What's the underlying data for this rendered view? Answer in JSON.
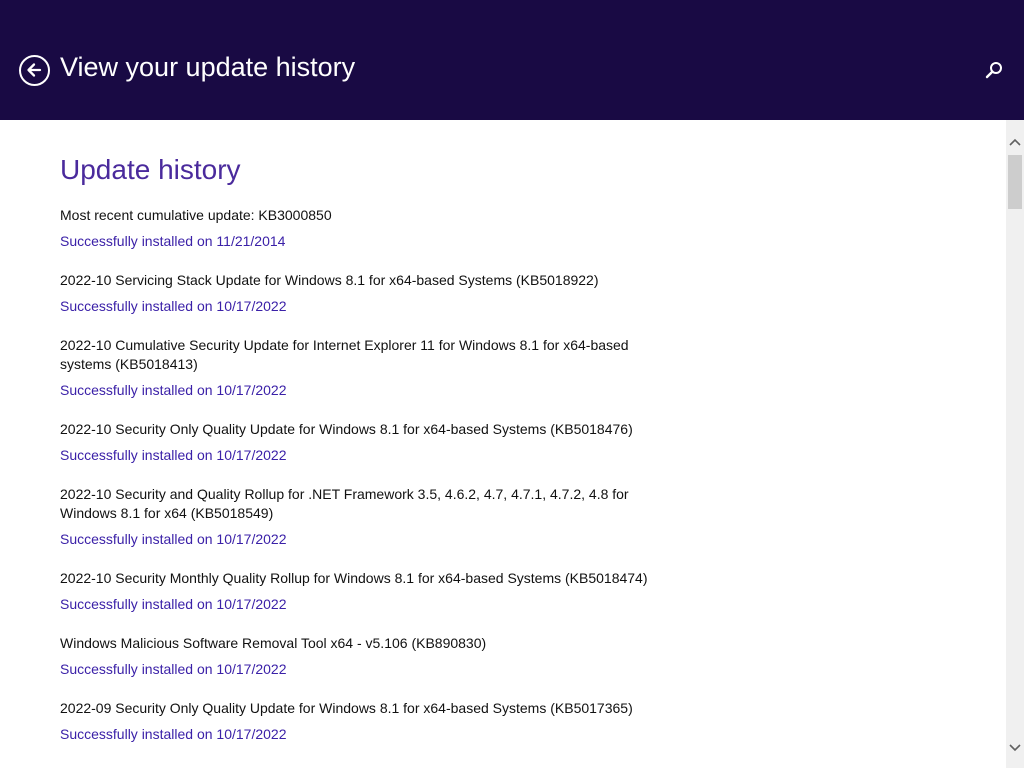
{
  "header": {
    "title": "View your update history",
    "back_icon": "back-arrow-icon",
    "search_icon": "search-icon",
    "background_color": "#190a44"
  },
  "main": {
    "section_title": "Update history",
    "accent_color": "#4a2a9c",
    "status_color": "#3b21a8",
    "updates": [
      {
        "name": "Most recent cumulative update: KB3000850",
        "status": "Successfully installed on 11/21/2014"
      },
      {
        "name": "2022-10 Servicing Stack Update for Windows 8.1 for x64-based Systems (KB5018922)",
        "status": "Successfully installed on 10/17/2022"
      },
      {
        "name": "2022-10 Cumulative Security Update for Internet Explorer 11 for Windows 8.1 for x64-based systems (KB5018413)",
        "status": "Successfully installed on 10/17/2022"
      },
      {
        "name": "2022-10 Security Only Quality Update for Windows 8.1 for x64-based Systems (KB5018476)",
        "status": "Successfully installed on 10/17/2022"
      },
      {
        "name": "2022-10 Security and Quality Rollup for .NET Framework 3.5, 4.6.2, 4.7, 4.7.1, 4.7.2, 4.8 for Windows 8.1 for x64 (KB5018549)",
        "status": "Successfully installed on 10/17/2022"
      },
      {
        "name": "2022-10 Security Monthly Quality Rollup for Windows 8.1 for x64-based Systems (KB5018474)",
        "status": "Successfully installed on 10/17/2022"
      },
      {
        "name": "Windows Malicious Software Removal Tool x64 - v5.106 (KB890830)",
        "status": "Successfully installed on 10/17/2022"
      },
      {
        "name": "2022-09 Security Only Quality Update for Windows 8.1 for x64-based Systems (KB5017365)",
        "status": "Successfully installed on 10/17/2022"
      }
    ]
  },
  "scrollbar": {
    "up_icon": "scroll-up-arrow-icon",
    "down_icon": "scroll-down-arrow-icon"
  }
}
